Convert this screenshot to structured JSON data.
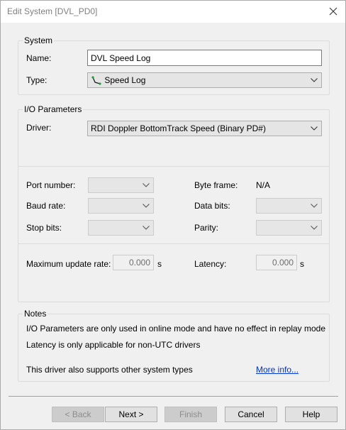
{
  "window": {
    "title": "Edit System [DVL_PD0]"
  },
  "system": {
    "group_title": "System",
    "name_label": "Name:",
    "name_value": "DVL Speed Log",
    "type_label": "Type:",
    "type_value": "Speed Log",
    "type_icon": "speed-log-icon"
  },
  "io": {
    "group_title": "I/O Parameters",
    "driver_label": "Driver:",
    "driver_value": "RDI Doppler BottomTrack Speed (Binary PD#)",
    "port_label": "Port number:",
    "baud_label": "Baud rate:",
    "stop_label": "Stop bits:",
    "byteframe_label": "Byte frame:",
    "byteframe_value": "N/A",
    "databits_label": "Data bits:",
    "parity_label": "Parity:",
    "max_rate_label": "Maximum update rate:",
    "max_rate_value": "0.000",
    "max_rate_unit": "s",
    "latency_label": "Latency:",
    "latency_value": "0.000",
    "latency_unit": "s"
  },
  "notes": {
    "group_title": "Notes",
    "line1": "I/O Parameters are only used in online mode and have no effect in replay mode",
    "line2": "Latency is only applicable for non-UTC drivers",
    "line3": "This driver also supports other system types",
    "more_info": "More info..."
  },
  "buttons": {
    "back": "< Back",
    "next": "Next >",
    "finish": "Finish",
    "cancel": "Cancel",
    "help": "Help"
  }
}
